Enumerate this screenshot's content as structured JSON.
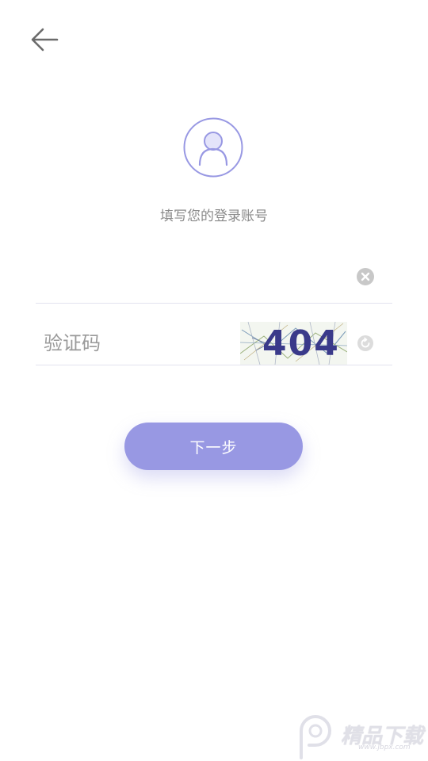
{
  "header": {
    "back_icon": "arrow-left-icon"
  },
  "avatar": {
    "icon": "user-icon",
    "color": "#9898e3"
  },
  "subtitle": "填写您的登录账号",
  "account": {
    "value": "",
    "placeholder": "",
    "clear_icon": "close-circle-icon"
  },
  "captcha": {
    "placeholder": "验证码",
    "image_text": "404",
    "refresh_icon": "refresh-icon"
  },
  "next_button": {
    "label": "下一步",
    "color": "#9898e3"
  },
  "watermark": {
    "text": "精品下载",
    "sub": "www.jbpx.com"
  }
}
